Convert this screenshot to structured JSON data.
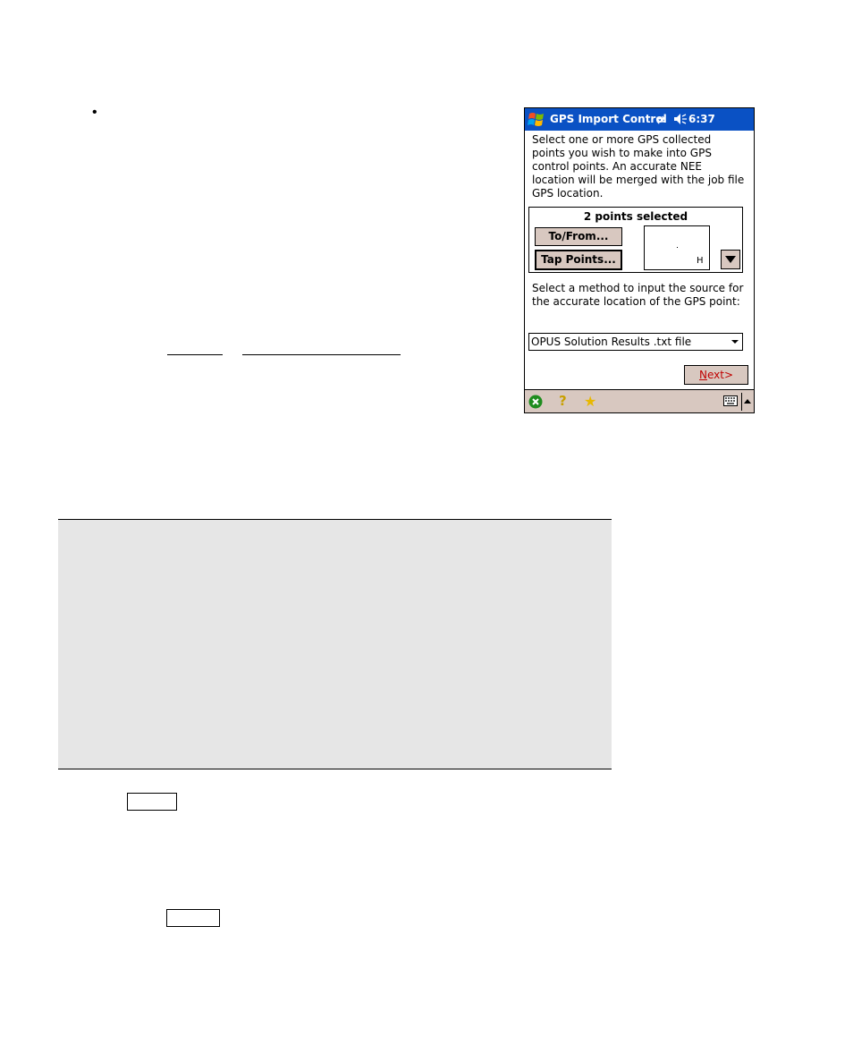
{
  "doc": {
    "bullet_glyph": "•"
  },
  "pda": {
    "title": "GPS Import Control",
    "time": "6:37",
    "intro": "Select one or more GPS collected points you wish to make into GPS control points. An accurate NEE location will be merged with the job file GPS location.",
    "points_selected": "2 points selected",
    "to_from_label": "To/From...",
    "tap_points_label": "Tap Points...",
    "preview_letter": "H",
    "method_prompt": "Select a method to input the source for the accurate location of the GPS point:",
    "method_selected": "OPUS Solution Results .txt file",
    "next_label_first": "N",
    "next_label_rest": "ext>",
    "colors": {
      "titlebar": "#0a51c4",
      "button_face": "#d8c8c0",
      "next_text": "#c00000",
      "note_bg": "#e6e6e6"
    },
    "icons": [
      "windows-start-icon",
      "sync-icon",
      "speaker-icon",
      "close-icon",
      "help-icon",
      "favorites-icon",
      "keyboard-icon",
      "sip-arrow-icon"
    ]
  }
}
